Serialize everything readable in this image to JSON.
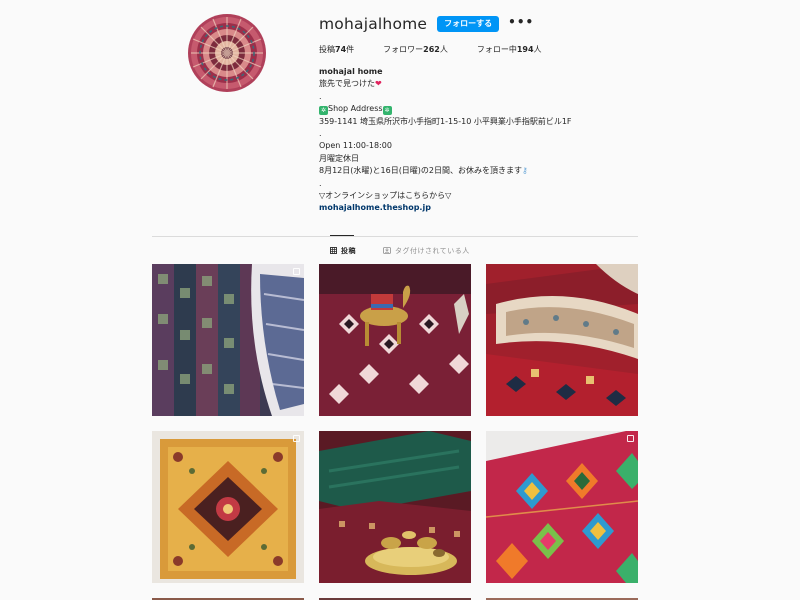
{
  "profile": {
    "username": "mohajalhome",
    "follow_label": "フォローする",
    "more_label": "•••",
    "stats": {
      "posts_label": "投稿",
      "posts_count": "74",
      "posts_unit": "件",
      "followers_label": "フォロワー",
      "followers_count": "262",
      "followers_unit": "人",
      "following_label": "フォロー中",
      "following_count": "194",
      "following_unit": "人"
    },
    "bio": {
      "name": "mohajal home",
      "line1": "旅先で見つけた",
      "dot1": ".",
      "shop_label": "Shop Address",
      "address": "359-1141 埼玉県所沢市小手指町1-15-10 小平興業小手指駅前ビル1F",
      "dot2": ".",
      "hours": "Open 11:00-18:00",
      "closed": "月曜定休日",
      "holiday": "8月12日(水曜)と16日(日曜)の2日間、お休みを頂きます",
      "dot3": ".",
      "online": "▽オンラインショップはこちらから▽",
      "link": "mohajalhome.theshop.jp"
    }
  },
  "tabs": {
    "posts": "投稿",
    "tagged": "タグ付けされている人"
  },
  "icons": {
    "grid": "grid-icon",
    "tagged": "tagged-user-icon",
    "more": "more-options-icon",
    "multi": "carousel-icon",
    "shop": "shop-emoji-icon",
    "heart": "heart-icon",
    "key": "key-icon"
  },
  "colors": {
    "accent": "#0095f6",
    "link": "#00376b",
    "text": "#262626",
    "muted": "#8e8e8e",
    "background": "#fafafa"
  }
}
